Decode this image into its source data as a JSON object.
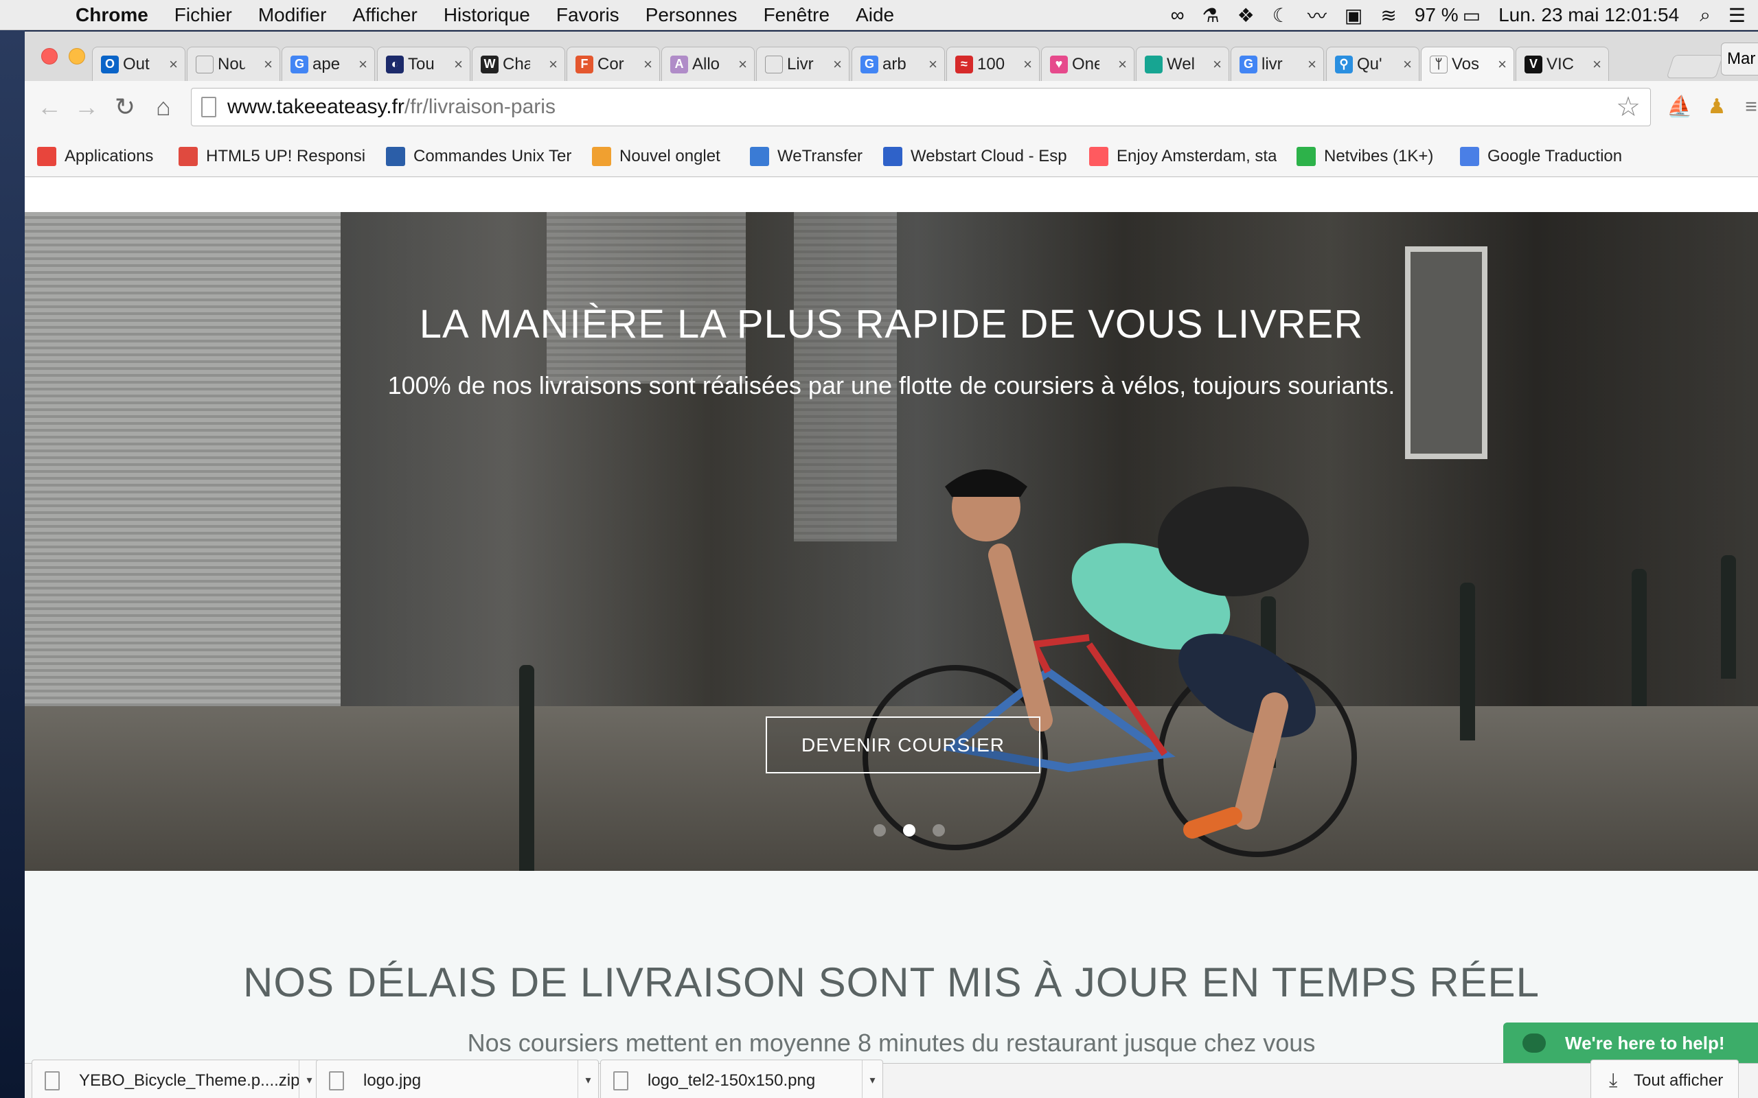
{
  "menubar": {
    "app_name": "Chrome",
    "items": [
      "Fichier",
      "Modifier",
      "Afficher",
      "Historique",
      "Favoris",
      "Personnes",
      "Fenêtre",
      "Aide"
    ],
    "battery": "97 %",
    "datetime": "Lun. 23 mai  12:01:54"
  },
  "tabs": [
    {
      "label": "Out",
      "icon": "outlook-icon",
      "color": "#0a64c8",
      "glyph": "O"
    },
    {
      "label": "Nouve",
      "icon": "blank-page-icon",
      "color": "#e7e7e7",
      "glyph": ""
    },
    {
      "label": "ape",
      "icon": "google-icon",
      "color": "#4285f4",
      "glyph": "G"
    },
    {
      "label": "Tou",
      "icon": "circle-logo-icon",
      "color": "#1c2a6a",
      "glyph": "◐"
    },
    {
      "label": "Cha",
      "icon": "wikipedia-icon",
      "color": "#222222",
      "glyph": "W"
    },
    {
      "label": "Cor",
      "icon": "f-logo-icon",
      "color": "#e4572e",
      "glyph": "F"
    },
    {
      "label": "Allo",
      "icon": "allo-icon",
      "color": "#b08cc8",
      "glyph": "A"
    },
    {
      "label": "Livr",
      "icon": "blank-page-icon",
      "color": "#e7e7e7",
      "glyph": ""
    },
    {
      "label": "arb",
      "icon": "google-icon",
      "color": "#4285f4",
      "glyph": "G"
    },
    {
      "label": "100",
      "icon": "red-logo-icon",
      "color": "#d62a2a",
      "glyph": "≈"
    },
    {
      "label": "One",
      "icon": "heart-icon",
      "color": "#e64a8c",
      "glyph": "♥"
    },
    {
      "label": "Wel",
      "icon": "teal-square-icon",
      "color": "#17a592",
      "glyph": ""
    },
    {
      "label": "livr",
      "icon": "google-icon",
      "color": "#4285f4",
      "glyph": "G"
    },
    {
      "label": "Qu'",
      "icon": "blue-bike-icon",
      "color": "#2a8fe0",
      "glyph": "⚲"
    },
    {
      "label": "Vos",
      "icon": "takeeateasy-icon",
      "color": "#f6f6f6",
      "glyph": "ᛘ"
    },
    {
      "label": "VIC",
      "icon": "vice-icon",
      "color": "#111111",
      "glyph": "V"
    }
  ],
  "profile_label": "Mar",
  "omnibox": {
    "domain": "www.takeeateasy.fr",
    "path": "/fr/livraison-paris"
  },
  "bookmarks": [
    {
      "label": "Applications",
      "icon": "apps-grid-icon",
      "color": "#e8453c"
    },
    {
      "label": "HTML5 UP! Responsi",
      "icon": "html5up-icon",
      "color": "#e04a3f"
    },
    {
      "label": "Commandes Unix Ter",
      "icon": "terminal-icon",
      "color": "#2b5ea8"
    },
    {
      "label": "Nouvel onglet",
      "icon": "boat-icon",
      "color": "#f0a030"
    },
    {
      "label": "WeTransfer",
      "icon": "wetransfer-icon",
      "color": "#3a7bd5"
    },
    {
      "label": "Webstart Cloud - Esp",
      "icon": "hashtag-icon",
      "color": "#2f62c9"
    },
    {
      "label": "Enjoy Amsterdam, sta",
      "icon": "airbnb-icon",
      "color": "#ff5a5f"
    },
    {
      "label": "Netvibes (1K+)",
      "icon": "netvibes-icon",
      "color": "#2db24a"
    },
    {
      "label": "Google Traduction",
      "icon": "google-translate-icon",
      "color": "#4a7fe6"
    }
  ],
  "hero": {
    "title": "LA MANIÈRE LA PLUS RAPIDE DE VOUS LIVRER",
    "subtitle": "100% de nos livraisons sont réalisées par une flotte de coursiers à vélos, toujours souriants.",
    "cta": "DEVENIR COURSIER"
  },
  "section2": {
    "title": "NOS DÉLAIS DE LIVRAISON SONT MIS À JOUR EN TEMPS RÉEL",
    "subtitle": "Nos coursiers mettent en moyenne 8 minutes du restaurant jusque chez vous"
  },
  "help_chat": "We're here to help!",
  "downloads": {
    "items": [
      "YEBO_Bicycle_Theme.p....zip",
      "logo.jpg",
      "logo_tel2-150x150.png"
    ],
    "show_all": "Tout afficher"
  }
}
